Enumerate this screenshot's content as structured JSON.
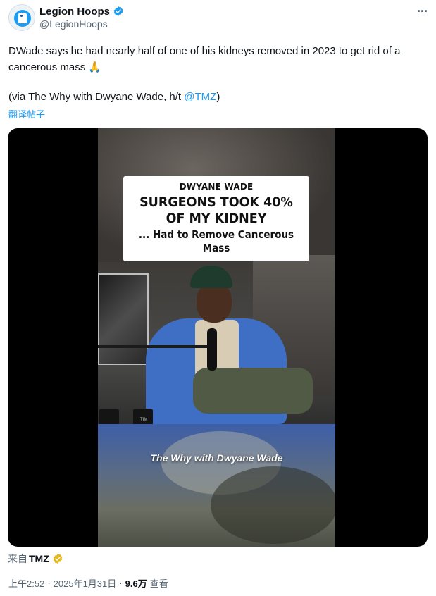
{
  "author": {
    "display_name": "Legion Hoops",
    "handle": "@LegionHoops",
    "verified_color": "#1d9bf0"
  },
  "tweet": {
    "text": "DWade says he had nearly half of one of his kidneys removed in 2023 to get rid of a cancerous mass",
    "emoji": "🙏",
    "via_prefix": "(via The Why with Dwyane Wade, h/t ",
    "via_mention": "@TMZ",
    "via_suffix": ")",
    "translate_label": "翻译帖子"
  },
  "media": {
    "headline_kicker": "DWYANE WADE",
    "headline_line1": "SURGEONS TOOK 40%",
    "headline_line2": "OF MY KIDNEY",
    "headline_sub1": "... Had to Remove Cancerous",
    "headline_sub2": "Mass",
    "caption": "The Why with Dwyane Wade",
    "mug_label": "TIM"
  },
  "source": {
    "prefix": "来自",
    "name": "TMZ",
    "badge_color": "#e2b719"
  },
  "meta": {
    "time": "上午2:52",
    "sep1": "·",
    "date": "2025年1月31日",
    "sep2": "·",
    "views_count": "9.6万",
    "views_label": "查看"
  }
}
